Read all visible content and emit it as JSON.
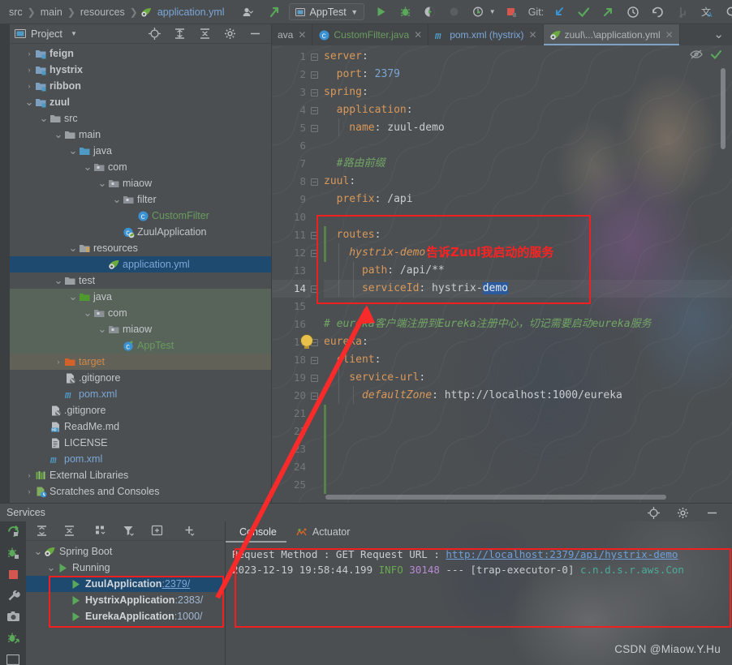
{
  "toolbar": {
    "breadcrumb": [
      "src",
      "main",
      "resources",
      "application.yml"
    ],
    "run_config": "AppTest",
    "git_label": "Git:",
    "icons": [
      "avatar-dropdown-icon",
      "update-project-icon",
      "run-icon",
      "debug-icon",
      "run-coverage-icon",
      "profiler-icon",
      "run-with-dropdown-icon",
      "stop-icon",
      "git-update-icon",
      "git-commit-icon",
      "git-push-icon",
      "git-history-icon",
      "git-rollback-icon",
      "git-branch-icon",
      "translate-icon",
      "search-icon",
      "settings-icon"
    ]
  },
  "project_panel": {
    "title": "Project",
    "header_icons": [
      "locate-icon",
      "expand-all-icon",
      "collapse-all-icon",
      "gear-icon",
      "hide-icon"
    ],
    "tree": [
      {
        "label": "feign",
        "indent": 1,
        "arrow": "right",
        "icon": "module-folder-icon",
        "bold": true
      },
      {
        "label": "hystrix",
        "indent": 1,
        "arrow": "right",
        "icon": "module-folder-icon",
        "bold": true
      },
      {
        "label": "ribbon",
        "indent": 1,
        "arrow": "right",
        "icon": "module-folder-icon",
        "bold": true
      },
      {
        "label": "zuul",
        "indent": 1,
        "arrow": "down",
        "icon": "module-folder-icon",
        "bold": true
      },
      {
        "label": "src",
        "indent": 2,
        "arrow": "down",
        "icon": "folder-icon"
      },
      {
        "label": "main",
        "indent": 3,
        "arrow": "down",
        "icon": "folder-icon"
      },
      {
        "label": "java",
        "indent": 4,
        "arrow": "down",
        "icon": "source-root-icon"
      },
      {
        "label": "com",
        "indent": 5,
        "arrow": "down",
        "icon": "package-icon"
      },
      {
        "label": "miaow",
        "indent": 6,
        "arrow": "down",
        "icon": "package-icon"
      },
      {
        "label": "filter",
        "indent": 7,
        "arrow": "down",
        "icon": "package-icon"
      },
      {
        "label": "CustomFilter",
        "indent": 8,
        "arrow": "none",
        "icon": "java-class-icon",
        "color": "#6a9b5f"
      },
      {
        "label": "ZuulApplication",
        "indent": 7,
        "arrow": "none",
        "icon": "spring-boot-class-icon"
      },
      {
        "label": "resources",
        "indent": 4,
        "arrow": "down",
        "icon": "resources-root-icon"
      },
      {
        "label": "application.yml",
        "indent": 6,
        "arrow": "none",
        "icon": "spring-yaml-icon",
        "selected": true,
        "color": "#7ba7d7"
      },
      {
        "label": "test",
        "indent": 3,
        "arrow": "down",
        "icon": "folder-icon"
      },
      {
        "label": "java",
        "indent": 4,
        "arrow": "down",
        "icon": "test-source-root-icon",
        "testsrc": true
      },
      {
        "label": "com",
        "indent": 5,
        "arrow": "down",
        "icon": "package-icon",
        "testsrc": true
      },
      {
        "label": "miaow",
        "indent": 6,
        "arrow": "down",
        "icon": "package-icon",
        "testsrc": true
      },
      {
        "label": "AppTest",
        "indent": 7,
        "arrow": "none",
        "icon": "test-class-icon",
        "testsrc": true,
        "color": "#6a9b5f"
      },
      {
        "label": "target",
        "indent": 3,
        "arrow": "right",
        "icon": "excluded-folder-icon",
        "targetrow": true,
        "color": "#cf8a4b"
      },
      {
        "label": ".gitignore",
        "indent": 3,
        "arrow": "none",
        "icon": "gitignore-icon"
      },
      {
        "label": "pom.xml",
        "indent": 3,
        "arrow": "none",
        "icon": "maven-icon",
        "color": "#7ba7d7"
      },
      {
        "label": ".gitignore",
        "indent": 2,
        "arrow": "none",
        "icon": "gitignore-icon"
      },
      {
        "label": "ReadMe.md",
        "indent": 2,
        "arrow": "none",
        "icon": "markdown-icon"
      },
      {
        "label": "LICENSE",
        "indent": 2,
        "arrow": "none",
        "icon": "text-file-icon"
      },
      {
        "label": "pom.xml",
        "indent": 2,
        "arrow": "none",
        "icon": "maven-icon",
        "color": "#7ba7d7"
      },
      {
        "label": "External Libraries",
        "indent": 1,
        "arrow": "right",
        "icon": "libraries-icon"
      },
      {
        "label": "Scratches and Consoles",
        "indent": 1,
        "arrow": "right",
        "icon": "scratches-icon"
      }
    ]
  },
  "editor": {
    "tabs": [
      {
        "label": "ava",
        "icon": "java-class-icon",
        "color": "grey",
        "active": false,
        "truncated": true
      },
      {
        "label": "CustomFilter.java",
        "icon": "java-class-icon",
        "color": "green",
        "active": false
      },
      {
        "label": "pom.xml (hystrix)",
        "icon": "maven-icon",
        "color": "blue",
        "active": false
      },
      {
        "label": "zuul\\...\\application.yml",
        "icon": "spring-yaml-icon",
        "color": "grey",
        "active": true
      }
    ],
    "line_numbers": [
      1,
      2,
      3,
      4,
      5,
      6,
      7,
      8,
      9,
      10,
      11,
      12,
      13,
      14,
      15,
      16,
      17,
      18,
      19,
      20,
      21,
      22,
      23,
      24,
      25
    ],
    "current_line": 14,
    "lines": [
      {
        "n": 1,
        "segs": [
          {
            "t": "server",
            "c": "k"
          },
          {
            "t": ":",
            "c": "v"
          }
        ]
      },
      {
        "n": 2,
        "segs": [
          {
            "t": "  port",
            "c": "k"
          },
          {
            "t": ": ",
            "c": "v"
          },
          {
            "t": "2379",
            "c": "num"
          }
        ]
      },
      {
        "n": 3,
        "segs": [
          {
            "t": "spring",
            "c": "k"
          },
          {
            "t": ":",
            "c": "v"
          }
        ]
      },
      {
        "n": 4,
        "segs": [
          {
            "t": "  application",
            "c": "k"
          },
          {
            "t": ":",
            "c": "v"
          }
        ]
      },
      {
        "n": 5,
        "segs": [
          {
            "t": "    name",
            "c": "k"
          },
          {
            "t": ": zuul-demo",
            "c": "v"
          }
        ]
      },
      {
        "n": 6,
        "segs": []
      },
      {
        "n": 7,
        "segs": [
          {
            "t": "  #路由前缀",
            "c": "cm"
          }
        ]
      },
      {
        "n": 8,
        "segs": [
          {
            "t": "zuul",
            "c": "k"
          },
          {
            "t": ":",
            "c": "v"
          }
        ]
      },
      {
        "n": 9,
        "segs": [
          {
            "t": "  prefix",
            "c": "k"
          },
          {
            "t": ": /api",
            "c": "v"
          }
        ]
      },
      {
        "n": 10,
        "segs": []
      },
      {
        "n": 11,
        "segs": [
          {
            "t": "  routes",
            "c": "k"
          },
          {
            "t": ":",
            "c": "v"
          }
        ]
      },
      {
        "n": 12,
        "segs": [
          {
            "t": "    hystrix-demo",
            "c": "ki"
          },
          {
            "t": ":",
            "c": "v"
          }
        ]
      },
      {
        "n": 13,
        "segs": [
          {
            "t": "      path",
            "c": "k"
          },
          {
            "t": ": /api/**",
            "c": "v"
          }
        ]
      },
      {
        "n": 14,
        "segs": [
          {
            "t": "      serviceId",
            "c": "k"
          },
          {
            "t": ": hystrix-",
            "c": "v"
          },
          {
            "t": "demo",
            "c": "sel-tok"
          }
        ]
      },
      {
        "n": 15,
        "segs": []
      },
      {
        "n": 16,
        "segs": [
          {
            "t": "# eureka客户端注册到Eureka注册中心，切记需要启动eureka服务",
            "c": "cm"
          }
        ]
      },
      {
        "n": 17,
        "segs": [
          {
            "t": "eureka",
            "c": "k"
          },
          {
            "t": ":",
            "c": "v"
          }
        ]
      },
      {
        "n": 18,
        "segs": [
          {
            "t": "  client",
            "c": "k"
          },
          {
            "t": ":",
            "c": "v"
          }
        ]
      },
      {
        "n": 19,
        "segs": [
          {
            "t": "    service-url",
            "c": "k"
          },
          {
            "t": ":",
            "c": "v"
          }
        ]
      },
      {
        "n": 20,
        "segs": [
          {
            "t": "      defaultZone",
            "c": "ki"
          },
          {
            "t": ": http://localhost:1000/eureka",
            "c": "v"
          }
        ]
      },
      {
        "n": 21,
        "segs": []
      },
      {
        "n": 22,
        "segs": []
      },
      {
        "n": 23,
        "segs": []
      },
      {
        "n": 24,
        "segs": []
      },
      {
        "n": 25,
        "segs": []
      }
    ],
    "inspection_status": "ok"
  },
  "services": {
    "title": "Services",
    "header_icons": [
      "locate-icon",
      "gear-icon",
      "hide-icon"
    ],
    "toolbar_icons": [
      "expand-all-icon",
      "collapse-all-icon",
      "group-by-icon",
      "filter-icon",
      "add-tab-icon",
      "add-icon"
    ],
    "stripe_icons": [
      "rerun-icon",
      "debug-icon",
      "stop-icon",
      "settings-wrench-icon",
      "screenshot-icon",
      "attach-debugger-icon",
      "console-icon"
    ],
    "tree": [
      {
        "label": "Spring Boot",
        "indent": 0,
        "arrow": "down",
        "icon": "spring-boot-icon"
      },
      {
        "label": "Running",
        "indent": 1,
        "arrow": "down",
        "icon": "run-icon"
      },
      {
        "label": "ZuulApplication",
        "indent": 2,
        "arrow": "none",
        "icon": "run-icon",
        "port": ":2379/",
        "selected": true,
        "port_link": true
      },
      {
        "label": "HystrixApplication",
        "indent": 2,
        "arrow": "none",
        "icon": "run-icon",
        "port": ":2383/"
      },
      {
        "label": "EurekaApplication",
        "indent": 2,
        "arrow": "none",
        "icon": "run-icon",
        "port": ":1000/"
      }
    ],
    "console": {
      "tabs": [
        {
          "label": "Console",
          "icon": "console-icon",
          "active": true
        },
        {
          "label": "Actuator",
          "icon": "actuator-icon",
          "active": false
        }
      ],
      "lines": [
        {
          "segs": [
            {
              "t": "Request Method : GET Request URL : ",
              "c": "v"
            },
            {
              "t": "http://localhost:2379/api/hystrix-demo",
              "c": "lnk"
            }
          ]
        },
        {
          "segs": [
            {
              "t": "2023-12-19 19:58:44.199  ",
              "c": "v"
            },
            {
              "t": "INFO ",
              "c": "info"
            },
            {
              "t": "30148",
              "c": "pid"
            },
            {
              "t": " --- [trap-executor-0] ",
              "c": "v"
            },
            {
              "t": "c.n.d.s.r.aws.Con",
              "c": "cls"
            }
          ]
        }
      ]
    }
  },
  "annotations": {
    "code_note": "告诉Zuul我启动的服务",
    "accent_color": "#f02020"
  },
  "watermark": "CSDN @Miaow.Y.Hu"
}
